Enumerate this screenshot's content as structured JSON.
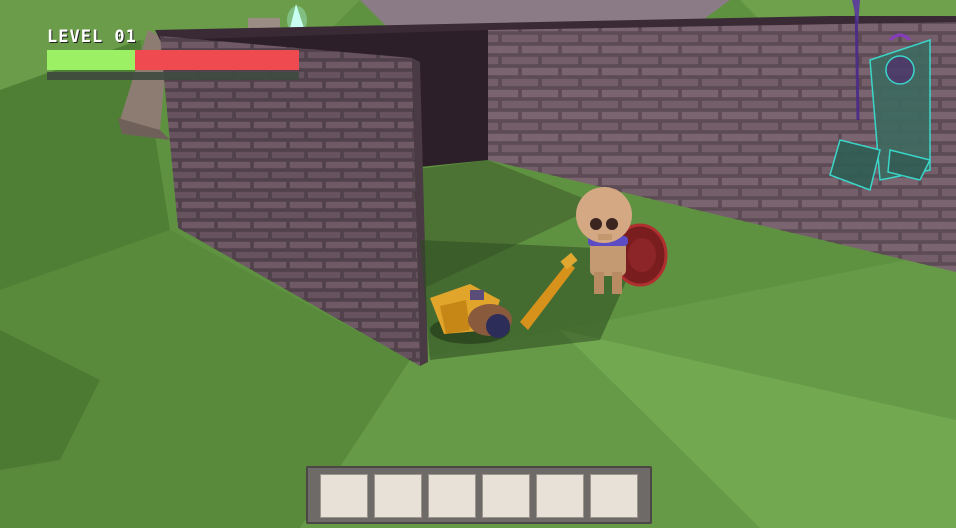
{
  "hud": {
    "level_label": "LEVEL 01",
    "health_fraction": 0.35,
    "colors": {
      "health": "#9cf064",
      "damage": "#ee4a4f"
    }
  },
  "hotbar": {
    "slots": [
      "",
      "",
      "",
      "",
      "",
      ""
    ]
  },
  "scene": {
    "ground_color": "#5b8a3c",
    "wall_color": "#6b5761",
    "characters": [
      "skeleton-warrior",
      "golden-beast",
      "ghost-wizard"
    ]
  }
}
